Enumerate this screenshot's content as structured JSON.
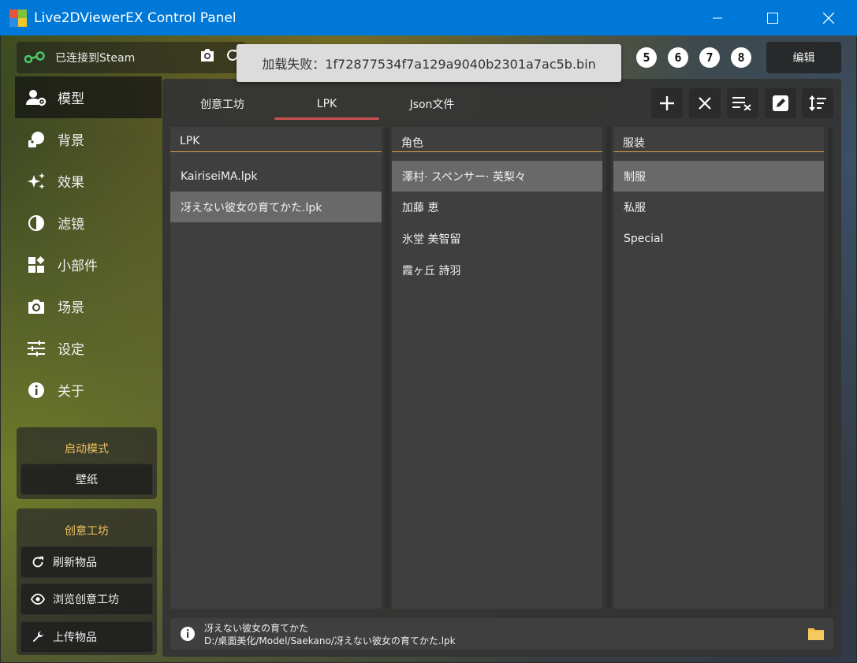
{
  "window": {
    "title": "Live2DViewerEX Control Panel",
    "controls": [
      "minimize-icon",
      "maximize-icon",
      "close-icon"
    ]
  },
  "topbar": {
    "steam_status": "已连接到Steam",
    "number_buttons": [
      "5",
      "6",
      "7",
      "8"
    ],
    "edit_label": "编辑"
  },
  "toast": {
    "message": "加载失败：1f72877534f7a129a9040b2301a7ac5b.bin"
  },
  "sidebar": {
    "items": [
      {
        "label": "模型",
        "icon": "person-gear-icon",
        "active": true
      },
      {
        "label": "背景",
        "icon": "image-icon",
        "active": false
      },
      {
        "label": "效果",
        "icon": "sparkles-icon",
        "active": false
      },
      {
        "label": "滤镜",
        "icon": "contrast-icon",
        "active": false
      },
      {
        "label": "小部件",
        "icon": "widgets-icon",
        "active": false
      },
      {
        "label": "场景",
        "icon": "camera-icon",
        "active": false
      },
      {
        "label": "设定",
        "icon": "sliders-icon",
        "active": false
      },
      {
        "label": "关于",
        "icon": "info-icon",
        "active": false
      }
    ],
    "launch_mode": {
      "heading": "启动模式",
      "value": "壁纸"
    },
    "workshop": {
      "heading": "创意工坊",
      "buttons": [
        {
          "label": "刷新物品",
          "icon": "refresh-icon"
        },
        {
          "label": "浏览创意工坊",
          "icon": "eye-icon"
        },
        {
          "label": "上传物品",
          "icon": "wrench-icon"
        }
      ]
    }
  },
  "main": {
    "tabs": [
      {
        "label": "创意工坊",
        "active": false
      },
      {
        "label": "LPK",
        "active": true
      },
      {
        "label": "Json文件",
        "active": false
      }
    ],
    "toolbar": [
      "add-icon",
      "remove-icon",
      "clear-list-icon",
      "rename-icon",
      "sort-icon"
    ],
    "columns": [
      {
        "header": "LPK",
        "items": [
          "KairiseiMA.lpk",
          "冴えない彼女の育てかた.lpk"
        ],
        "selected": 1
      },
      {
        "header": "角色",
        "items": [
          "澤村· スペンサー· 英梨々",
          "加藤 恵",
          "氷堂 美智留",
          "霞ヶ丘 詩羽"
        ],
        "selected": 0
      },
      {
        "header": "服装",
        "items": [
          "制服",
          "私服",
          "Special"
        ],
        "selected": 0
      }
    ],
    "info": {
      "name": "冴えない彼女の育てかた",
      "path": "D:/桌面美化/Model/Saekano/冴えない彼女の育てかた.lpk"
    }
  }
}
